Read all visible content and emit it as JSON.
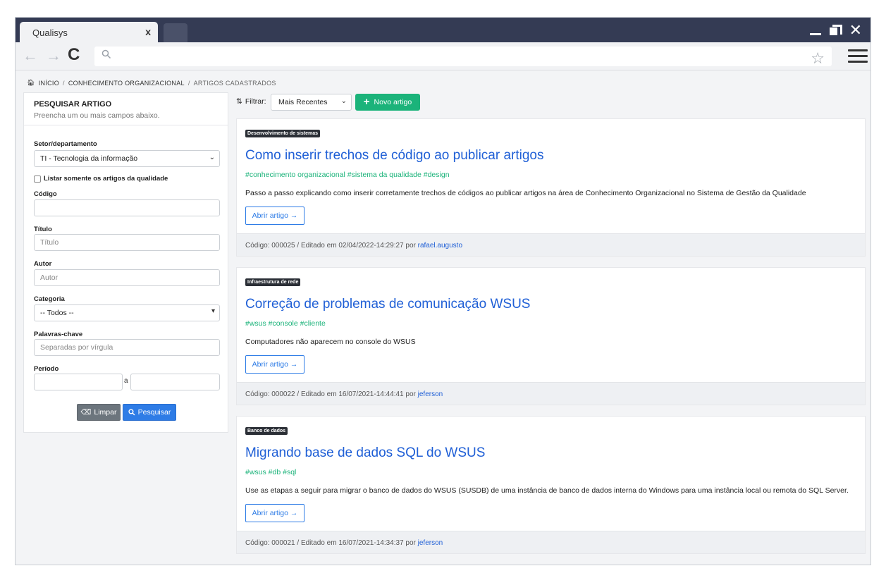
{
  "browser": {
    "tab_title": "Qualisys",
    "tab_close": "x",
    "url": ""
  },
  "breadcrumb": [
    "INÍCIO",
    "CONHECIMENTO ORGANIZACIONAL",
    "ARTIGOS CADASTRADOS"
  ],
  "sidebar": {
    "title": "PESQUISAR ARTIGO",
    "subtitle": "Preencha um ou mais campos abaixo.",
    "setor_label": "Setor/departamento",
    "setor_value": "TI - Tecnologia da informação",
    "checkbox_label": "Listar somente os artigos da qualidade",
    "codigo_label": "Código",
    "codigo_value": "",
    "titulo_label": "Título",
    "titulo_placeholder": "Título",
    "autor_label": "Autor",
    "autor_placeholder": "Autor",
    "categoria_label": "Categoria",
    "categoria_value": "-- Todos --",
    "palavras_label": "Palavras-chave",
    "palavras_placeholder": "Separadas por vírgula",
    "periodo_label": "Período",
    "periodo_sep": "a",
    "clear_label": "Limpar",
    "search_label": "Pesquisar"
  },
  "toolbar": {
    "filter_label": "Filtrar:",
    "filter_value": "Mais Recentes",
    "new_label": "Novo artigo"
  },
  "articles": [
    {
      "category": "Desenvolvimento de sistemas",
      "title": "Como inserir trechos de código ao publicar artigos",
      "tags": "#conhecimento organizacional #sistema da qualidade #design",
      "description": "Passo a passo explicando como inserir corretamente trechos de códigos ao publicar artigos na área de Conhecimento Organizacional no Sistema de Gestão da Qualidade",
      "button": "Abrir artigo →",
      "footer": "Código: 000025 / Editado em 02/04/2022-14:29:27 por",
      "user": "rafael.augusto"
    },
    {
      "category": "Infraestrutura de rede",
      "title": "Correção de problemas de comunicação WSUS",
      "tags": "#wsus #console #cliente",
      "description": "Computadores não aparecem no console do WSUS",
      "button": "Abrir artigo →",
      "footer": "Código: 000022 / Editado em 16/07/2021-14:44:41 por",
      "user": "jeferson"
    },
    {
      "category": "Banco de dados",
      "title": "Migrando base de dados SQL do WSUS",
      "tags": "#wsus #db #sql",
      "description": "Use as etapas a seguir para migrar o banco de dados do WSUS (SUSDB) de uma instância de banco de dados interna do Windows para uma instância local ou remota do SQL Server.",
      "button": "Abrir artigo →",
      "footer": "Código: 000021 / Editado em 16/07/2021-14:34:37 por",
      "user": "jeferson"
    }
  ],
  "colors": {
    "titlebar": "#343b54",
    "link_blue": "#1f5fd6",
    "tag_green": "#1bb37a",
    "primary": "#2e7ce6",
    "secondary": "#6c757d"
  }
}
